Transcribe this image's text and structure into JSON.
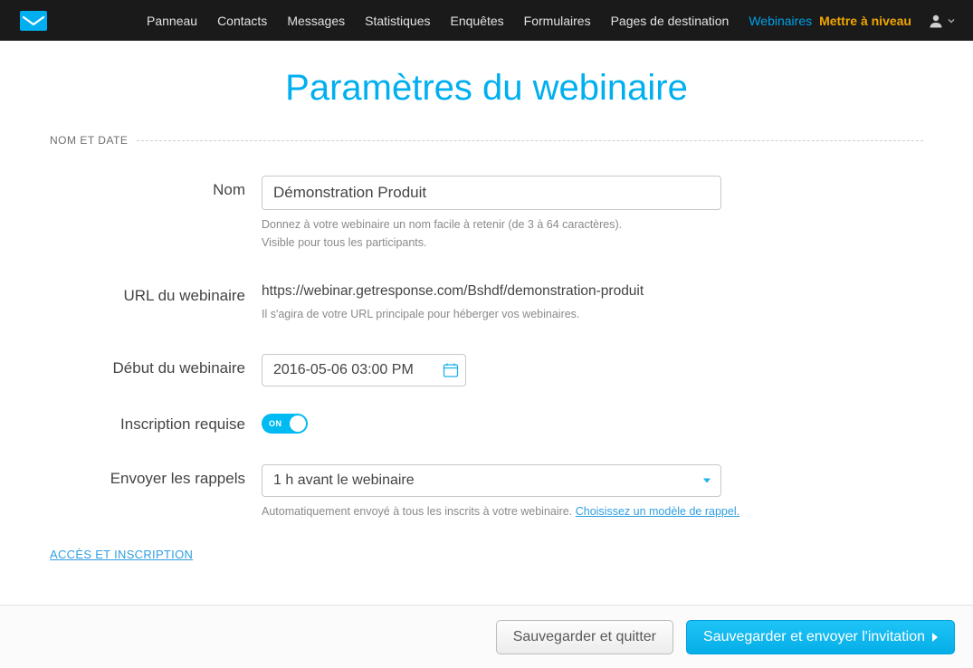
{
  "nav": {
    "items": [
      {
        "label": "Panneau"
      },
      {
        "label": "Contacts"
      },
      {
        "label": "Messages"
      },
      {
        "label": "Statistiques"
      },
      {
        "label": "Enquêtes"
      },
      {
        "label": "Formulaires"
      },
      {
        "label": "Pages de destination"
      },
      {
        "label": "Webinaires",
        "active": true
      }
    ],
    "upgrade": "Mettre à niveau"
  },
  "page": {
    "title": "Paramètres du webinaire",
    "section_label": "NOM ET DATE",
    "access_link": "ACCÈS ET INSCRIPTION"
  },
  "form": {
    "name": {
      "label": "Nom",
      "value": "Démonstration Produit",
      "help1": "Donnez à votre webinaire un nom facile à retenir (de 3 à 64 caractères).",
      "help2": "Visible pour tous les participants."
    },
    "url": {
      "label": "URL du webinaire",
      "value": "https://webinar.getresponse.com/Bshdf/demonstration-produit",
      "help": "Il s'agira de votre URL principale pour héberger vos webinaires."
    },
    "start": {
      "label": "Début du webinaire",
      "value": "2016-05-06 03:00 PM"
    },
    "registration": {
      "label": "Inscription requise",
      "toggle_text": "ON"
    },
    "reminders": {
      "label": "Envoyer les rappels",
      "value": "1 h avant le webinaire",
      "help_prefix": "Automatiquement envoyé à tous les inscrits à votre webinaire. ",
      "help_link": "Choisissez un modèle de rappel."
    }
  },
  "buttons": {
    "save_quit": "Sauvegarder et quitter",
    "save_send": "Sauvegarder et envoyer l'invitation"
  }
}
